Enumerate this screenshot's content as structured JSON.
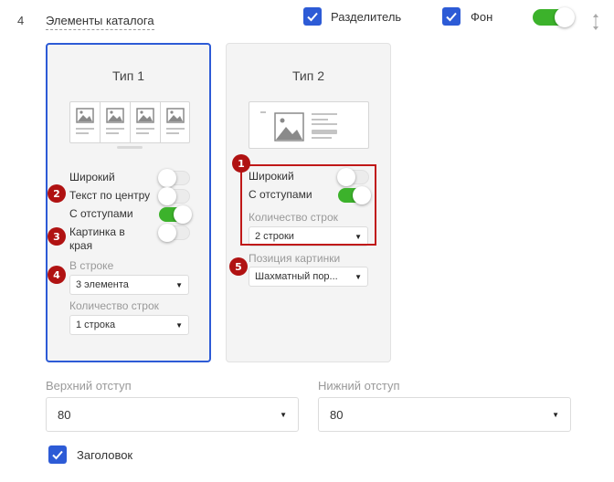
{
  "header": {
    "section_number": "4",
    "section_title": "Элементы каталога",
    "divider_checkbox": {
      "label": "Разделитель",
      "checked": true
    },
    "background_checkbox": {
      "label": "Фон",
      "checked": true
    },
    "toggle_on": true,
    "drag_icon": "drag-handle-icon"
  },
  "type1": {
    "title": "Тип 1",
    "options": {
      "wide": {
        "label": "Широкий",
        "on": false
      },
      "center_text": {
        "label": "Текст по центру",
        "on": false
      },
      "with_spacing": {
        "label": "С отступами",
        "on": true
      },
      "image_edge": {
        "label": "Картинка в края",
        "on": false
      }
    },
    "in_row_label": "В строке",
    "in_row_value": "3 элемента",
    "rows_label": "Количество строк",
    "rows_value": "1 строка"
  },
  "type2": {
    "title": "Тип 2",
    "options": {
      "wide": {
        "label": "Широкий",
        "on": false
      },
      "with_spacing": {
        "label": "С отступами",
        "on": true
      }
    },
    "rows_label": "Количество строк",
    "rows_value": "2 строки",
    "image_position_label": "Позиция картинки",
    "image_position_value": "Шахматный пор..."
  },
  "badges": [
    "1",
    "2",
    "3",
    "4",
    "5"
  ],
  "spacing": {
    "top_label": "Верхний отступ",
    "top_value": "80",
    "bottom_label": "Нижний отступ",
    "bottom_value": "80"
  },
  "heading_checkbox": {
    "label": "Заголовок",
    "checked": true
  },
  "colors": {
    "accent": "#2d5bd6",
    "toggle_on": "#3cb22b",
    "badge": "#b01212"
  }
}
